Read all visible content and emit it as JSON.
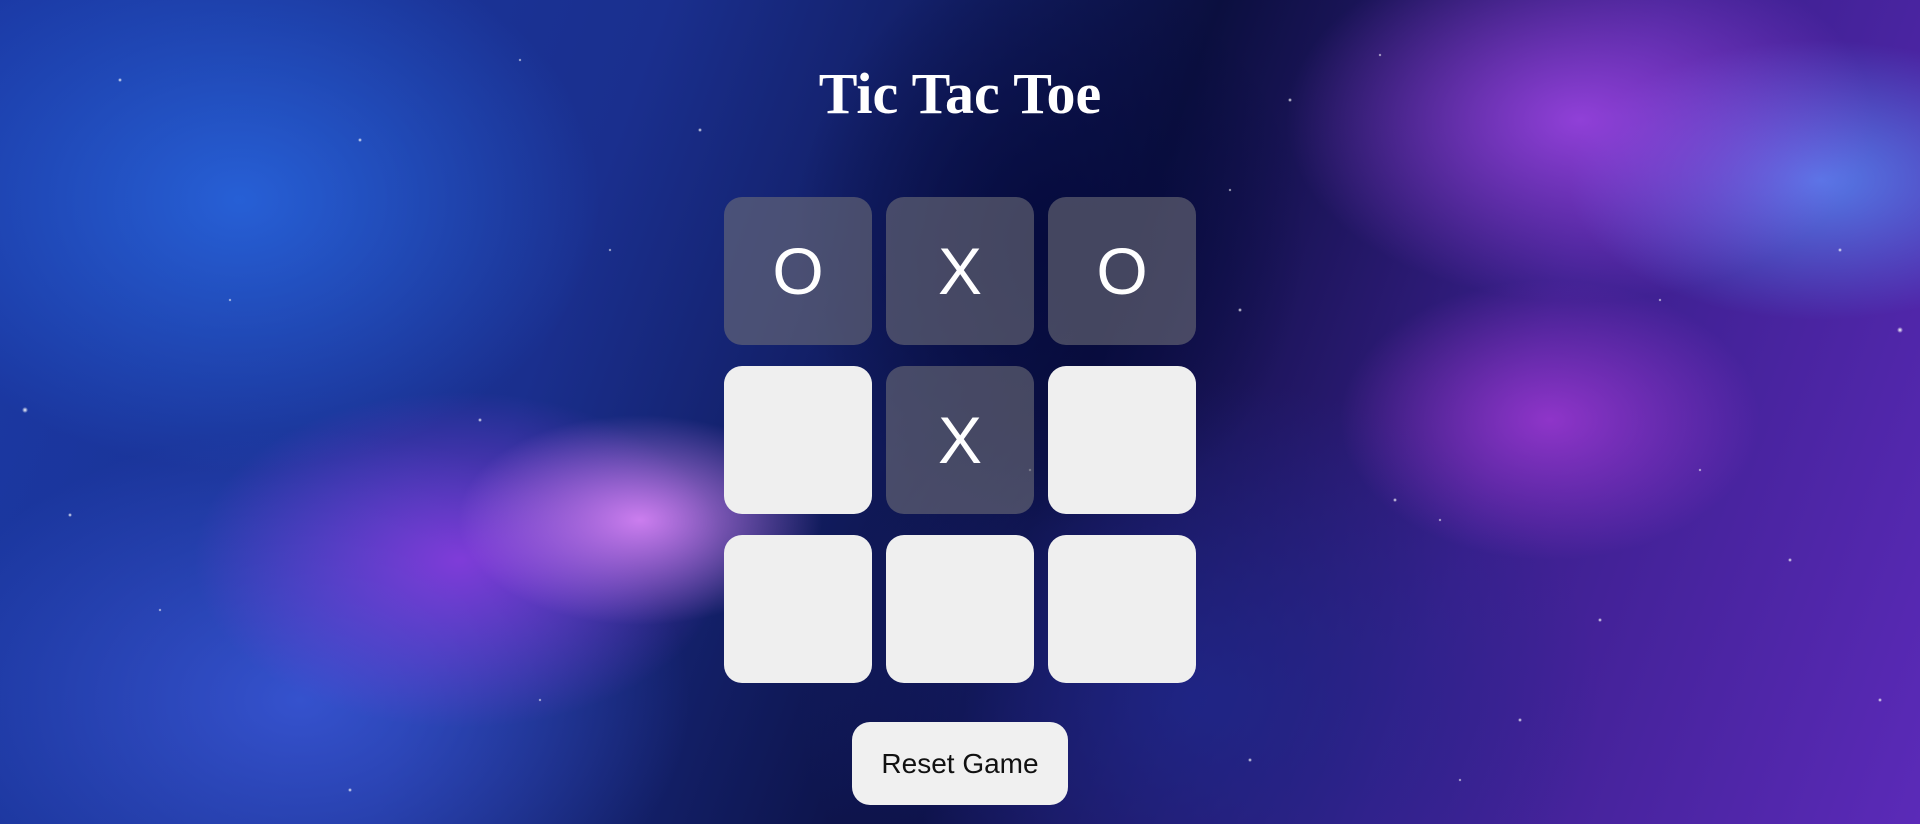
{
  "game": {
    "title": "Tic Tac Toe",
    "board": [
      "O",
      "X",
      "O",
      "",
      "X",
      "",
      "",
      "",
      ""
    ],
    "reset_label": "Reset Game"
  },
  "colors": {
    "empty_cell": "#efefef",
    "filled_cell": "rgba(110,110,120,0.6)",
    "mark": "#ffffff",
    "title": "#ffffff"
  }
}
